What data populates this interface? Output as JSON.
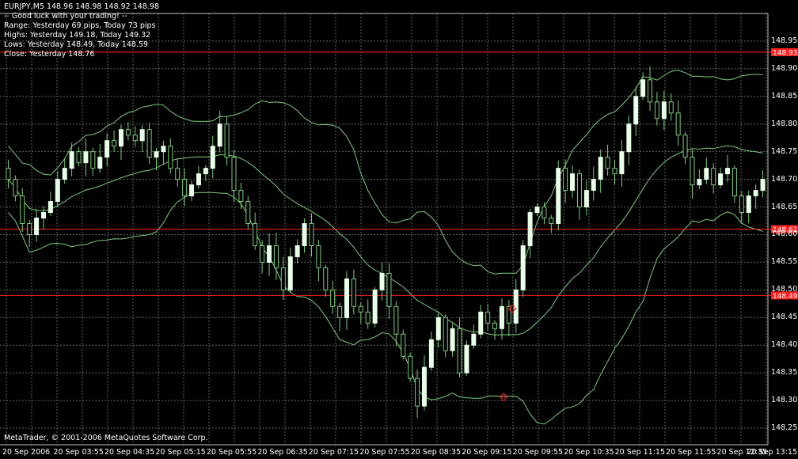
{
  "header": {
    "symbol_line": "EURJPY,M5  148.96 148.98 148.92 148.98",
    "greeting": "-- Good luck with your trading! --",
    "range": "Range: Yesterday 69 pips, Today 73 pips",
    "highs": "Highs: Yesterday 149.18, Today 149.32",
    "lows": "Lows: Yesterday 148.49, Today 148.59",
    "close": "Close: Yesterday 148.76"
  },
  "footer": {
    "copyright": "MetaTrader, © 2001-2006 MetaQuotes Software Corp."
  },
  "colors": {
    "background": "#000000",
    "grid": "#5a6a5a",
    "candle_up": "#e8ffe8",
    "candle_down": "#000000",
    "wick": "#7ccd7c",
    "bands": "#7ccd7c",
    "level_line": "#ff2020",
    "arrow": "#ff2020"
  },
  "chart_data": {
    "type": "candlestick",
    "symbol": "EURJPY",
    "timeframe": "M5",
    "ylim": [
      148.22,
      149.0
    ],
    "yticks": [
      "148.95",
      "148.90",
      "148.85",
      "148.80",
      "148.75",
      "148.70",
      "148.65",
      "148.60",
      "148.55",
      "148.50",
      "148.45",
      "148.40",
      "148.35",
      "148.30",
      "148.25"
    ],
    "xticks": [
      "20 Sep 2006",
      "20 Sep 03:55",
      "20 Sep 04:35",
      "20 Sep 05:15",
      "20 Sep 05:55",
      "20 Sep 06:35",
      "20 Sep 07:15",
      "20 Sep 07:55",
      "20 Sep 08:35",
      "20 Sep 09:15",
      "20 Sep 09:55",
      "20 Sep 10:35",
      "20 Sep 11:15",
      "20 Sep 11:55",
      "20 Sep 12:35",
      "20 Sep 13:15"
    ],
    "levels": [
      {
        "value": 148.93,
        "label": "148.93"
      },
      {
        "value": 148.61,
        "label": "148.61"
      },
      {
        "value": 148.49,
        "label": "148.49"
      }
    ],
    "closes": [
      148.7,
      148.67,
      148.62,
      148.6,
      148.63,
      148.64,
      148.66,
      148.7,
      148.72,
      148.75,
      148.73,
      148.75,
      148.72,
      148.74,
      148.77,
      148.76,
      148.79,
      148.78,
      148.77,
      148.79,
      148.74,
      148.75,
      148.76,
      148.72,
      148.7,
      148.67,
      148.69,
      148.71,
      148.72,
      148.76,
      148.8,
      148.74,
      148.68,
      148.66,
      148.62,
      148.58,
      148.55,
      148.58,
      148.54,
      148.5,
      148.56,
      148.58,
      148.62,
      148.58,
      148.54,
      148.5,
      148.47,
      148.45,
      148.52,
      148.47,
      148.46,
      148.44,
      148.5,
      148.53,
      148.47,
      148.42,
      148.38,
      148.34,
      148.29,
      148.36,
      148.41,
      148.45,
      148.39,
      148.43,
      148.35,
      148.4,
      148.42,
      148.46,
      148.44,
      148.43,
      148.47,
      148.44,
      148.5,
      148.58,
      148.64,
      148.65,
      148.63,
      148.62,
      148.72,
      148.68,
      148.71,
      148.65,
      148.68,
      148.7,
      148.74,
      148.72,
      148.71,
      148.75,
      148.8,
      148.85,
      148.88,
      148.84,
      148.81,
      148.84,
      148.82,
      148.78,
      148.74,
      148.69,
      148.7,
      148.72,
      148.69,
      148.71,
      148.72,
      148.67,
      148.64,
      148.67,
      148.68,
      148.7
    ]
  }
}
